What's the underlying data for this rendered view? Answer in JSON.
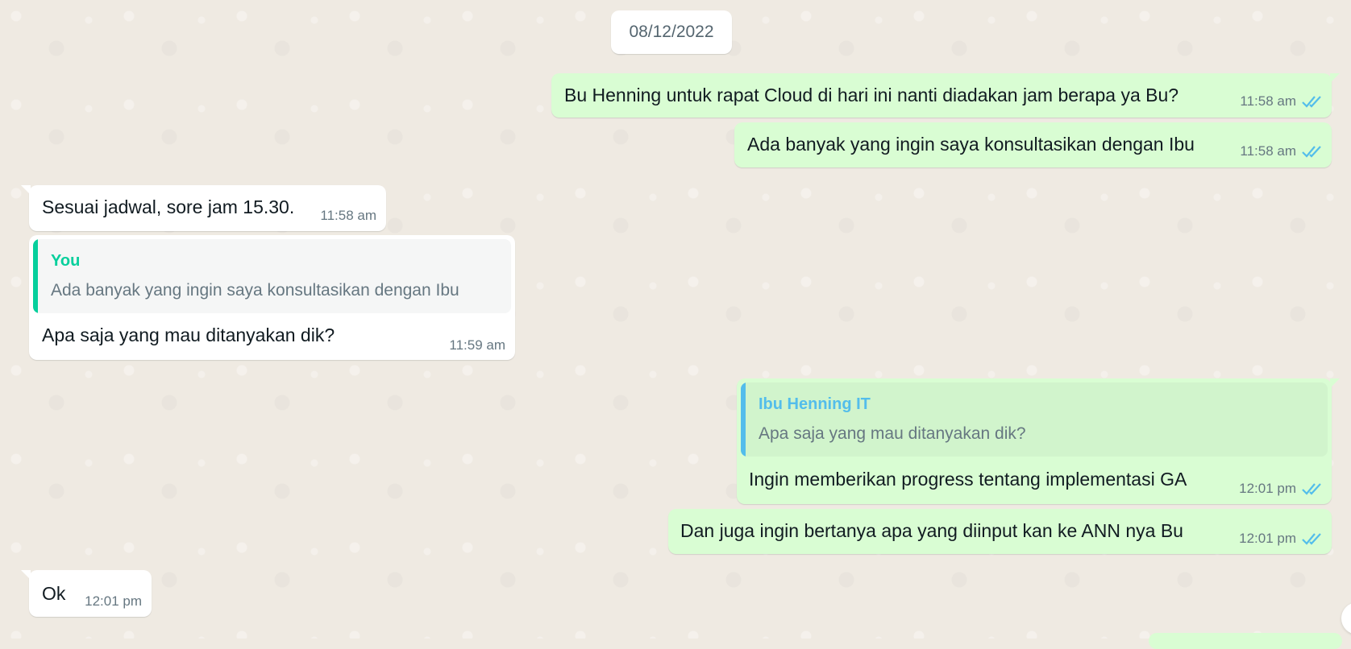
{
  "chat": {
    "date_label": "08/12/2022",
    "messages": [
      {
        "dir": "out",
        "text": "Bu Henning untuk rapat Cloud di hari ini nanti diadakan jam berapa ya Bu?",
        "time": "11:58 am",
        "status": "read"
      },
      {
        "dir": "out",
        "text": "Ada banyak yang ingin saya konsultasikan dengan Ibu",
        "time": "11:58 am",
        "status": "read"
      },
      {
        "dir": "in",
        "text": "Sesuai jadwal, sore jam 15.30.",
        "time": "11:58 am"
      },
      {
        "dir": "in",
        "quote": {
          "author": "You",
          "text": "Ada banyak yang ingin saya konsultasikan dengan Ibu"
        },
        "text": "Apa saja yang mau ditanyakan dik?",
        "time": "11:59 am"
      },
      {
        "dir": "out",
        "quote": {
          "author": "Ibu Henning IT",
          "text": "Apa saja yang mau ditanyakan dik?"
        },
        "text": "Ingin memberikan progress tentang implementasi GA",
        "time": "12:01 pm",
        "status": "read"
      },
      {
        "dir": "out",
        "text": "Dan juga ingin bertanya apa yang diinput kan ke ANN nya Bu",
        "time": "12:01 pm",
        "status": "read"
      },
      {
        "dir": "in",
        "text": "Ok",
        "time": "12:01 pm"
      }
    ]
  },
  "colors": {
    "background": "#efeae2",
    "outgoing_bubble": "#d9fdd3",
    "incoming_bubble": "#ffffff",
    "read_ticks": "#53bdeb",
    "quote_you": "#06cf9c",
    "quote_contact": "#53bdeb"
  },
  "icons": {
    "read_status": "double-check-icon"
  }
}
